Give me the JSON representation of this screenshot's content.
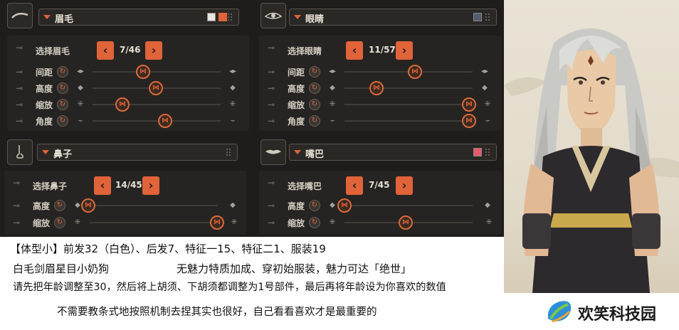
{
  "panels": {
    "eyebrow": {
      "title": "眉毛",
      "select_label": "选择眉毛",
      "counter": "7/46",
      "swatch": "#e8e6e0",
      "swatch2": "#e0633a",
      "rows": [
        {
          "label": "间距"
        },
        {
          "label": "高度"
        },
        {
          "label": "缩放"
        },
        {
          "label": "角度"
        }
      ],
      "knob_positions": [
        0.45,
        0.52,
        0.25,
        0.62
      ]
    },
    "eye": {
      "title": "眼睛",
      "select_label": "选择眼睛",
      "counter": "11/57",
      "swatch": "#535b6e",
      "rows": [
        {
          "label": "间距"
        },
        {
          "label": "高度"
        },
        {
          "label": "缩放"
        },
        {
          "label": "角度"
        }
      ],
      "knob_positions": [
        0.55,
        0.25,
        0.97,
        0.97
      ]
    },
    "nose": {
      "title": "鼻子",
      "select_label": "选择鼻子",
      "counter": "14/45",
      "rows": [
        {
          "label": "高度"
        },
        {
          "label": "缩放"
        }
      ],
      "knob_positions": [
        0.02,
        0.98
      ]
    },
    "mouth": {
      "title": "嘴巴",
      "select_label": "选择嘴巴",
      "counter": "7/45",
      "swatch": "#e85a6a",
      "rows": [
        {
          "label": "高度"
        },
        {
          "label": "缩放"
        }
      ],
      "knob_positions": [
        0.0,
        0.46
      ]
    }
  },
  "captions": {
    "line1": "【体型小】前发32（白色）、后发7、特征一15、特征二1、服装19",
    "line2a": "白毛剑眉星目小奶狗",
    "line2b": "无魅力特质加成、穿初始服装，魅力可达「绝世」",
    "line3": "请先把年龄调整至30，然后将上胡须、下胡须都调整为1号部件，最后再将年龄设为你喜欢的数值",
    "line4": "不需要教条式地按照机制去捏其实也很好，自己看看喜欢才是最重要的"
  },
  "watermark": {
    "text": "欢笑科技园"
  },
  "colors": {
    "accent": "#e0633a",
    "panel_bg": "#1f1d1b",
    "row_bg": "#262422"
  }
}
